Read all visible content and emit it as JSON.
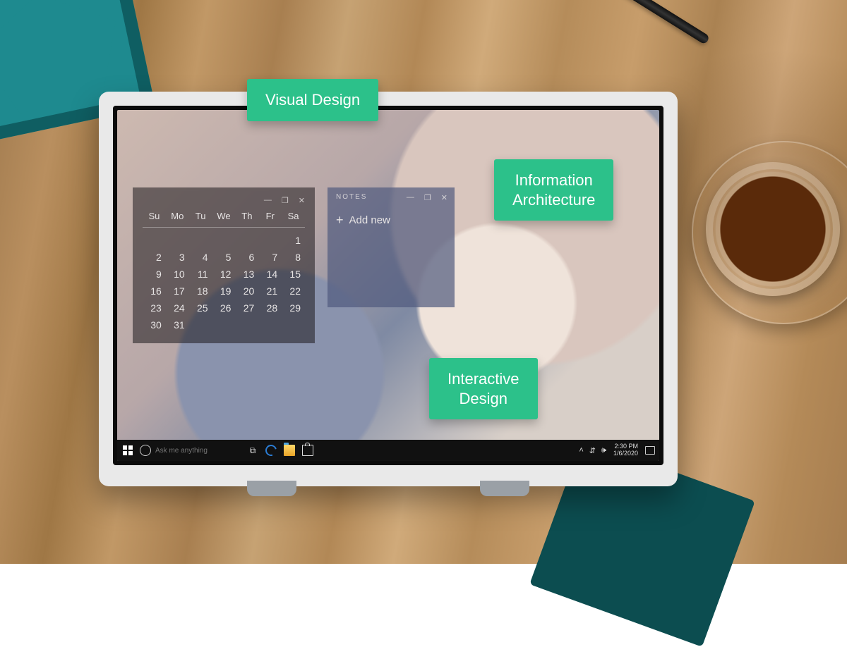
{
  "tags": {
    "visual_design": "Visual Design",
    "information_architecture": "Information\nArchitecture",
    "interactive_design": "Interactive\nDesign"
  },
  "calendar": {
    "days": [
      "Su",
      "Mo",
      "Tu",
      "We",
      "Th",
      "Fr",
      "Sa"
    ],
    "weeks": [
      [
        "",
        "",
        "",
        "",
        "",
        "",
        "1"
      ],
      [
        "2",
        "3",
        "4",
        "5",
        "6",
        "7",
        "8"
      ],
      [
        "9",
        "10",
        "11",
        "12",
        "13",
        "14",
        "15"
      ],
      [
        "16",
        "17",
        "18",
        "19",
        "20",
        "21",
        "22"
      ],
      [
        "23",
        "24",
        "25",
        "26",
        "27",
        "28",
        "29"
      ],
      [
        "30",
        "31",
        "",
        "",
        "",
        "",
        ""
      ]
    ],
    "controls": {
      "min": "—",
      "max": "❐",
      "close": "✕"
    }
  },
  "notes": {
    "title": "NOTES",
    "add_new": "Add new",
    "controls": {
      "min": "—",
      "max": "❐",
      "close": "✕"
    }
  },
  "taskbar": {
    "search_placeholder": "Ask me anything",
    "tray_up": "˄",
    "wifi": "⇵",
    "sound": "🕪",
    "time": "2:30 PM",
    "date": "1/6/2020"
  }
}
